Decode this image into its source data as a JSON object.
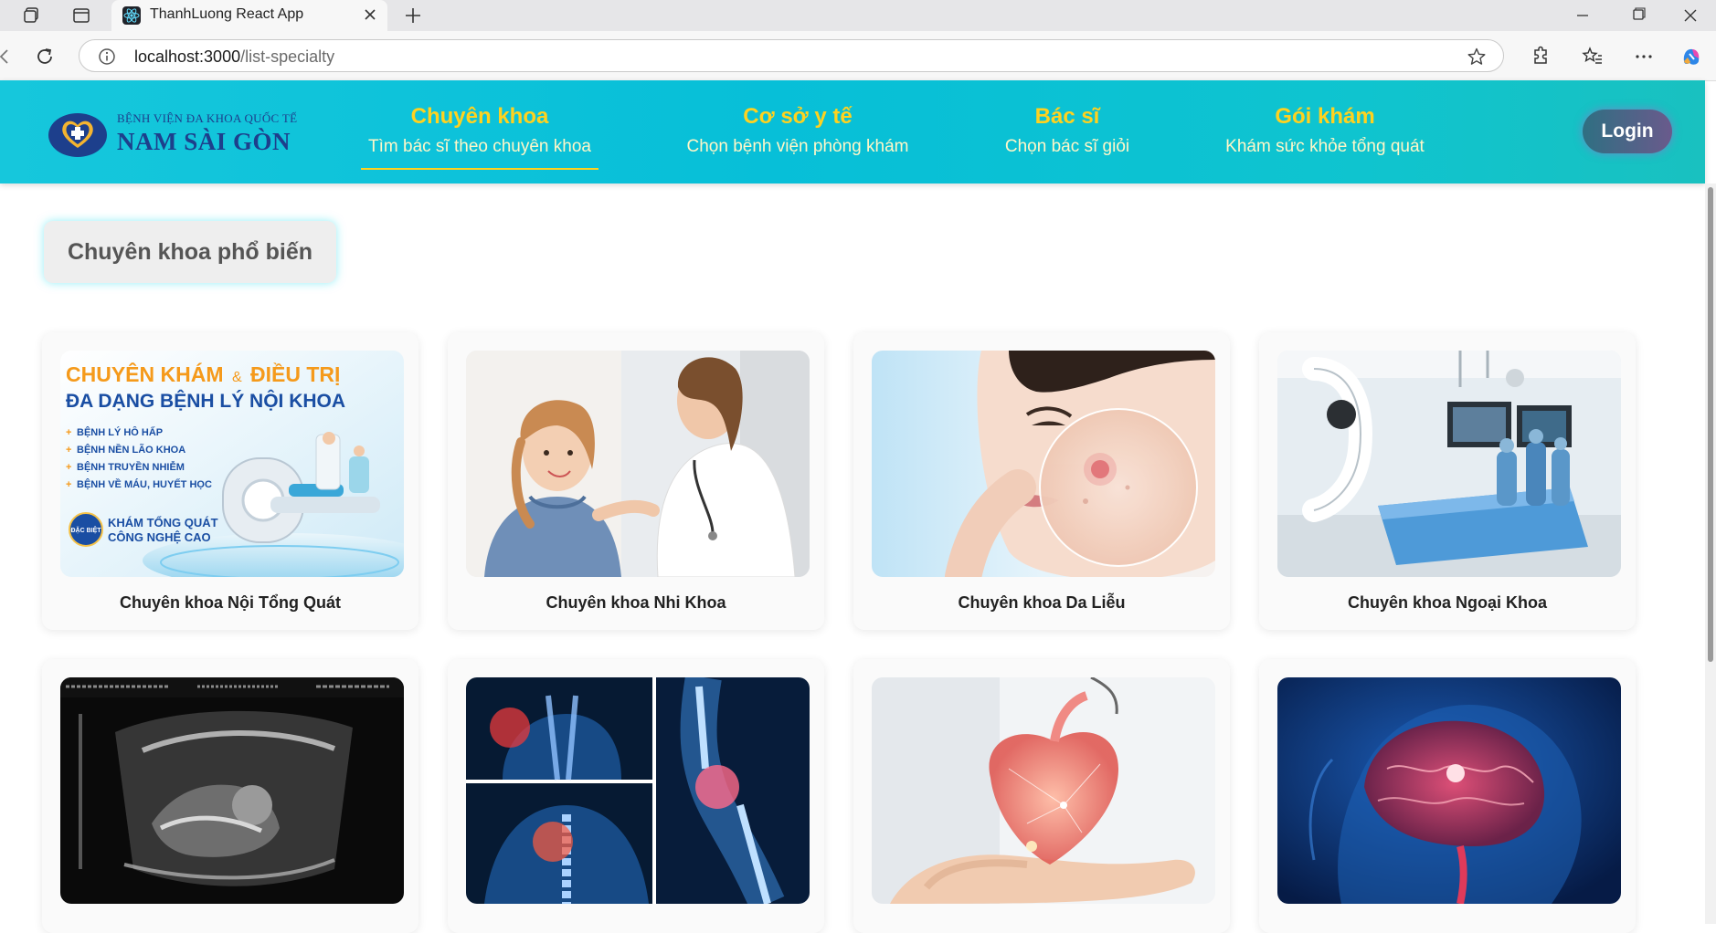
{
  "browser": {
    "tab_title": "ThanhLuong React App",
    "url_host": "localhost:3000",
    "url_path": "/list-specialty"
  },
  "header": {
    "logo_small": "BỆNH VIỆN ĐA KHOA QUỐC TẾ",
    "logo_big": "NAM SÀI GÒN",
    "nav": [
      {
        "title": "Chuyên khoa",
        "subtitle": "Tìm bác sĩ theo chuyên khoa",
        "active": true
      },
      {
        "title": "Cơ sở y tế",
        "subtitle": "Chọn bệnh viện phòng khám",
        "active": false
      },
      {
        "title": "Bác sĩ",
        "subtitle": "Chọn bác sĩ giỏi",
        "active": false
      },
      {
        "title": "Gói khám",
        "subtitle": "Khám sức khỏe tổng quát",
        "active": false
      }
    ],
    "login_label": "Login"
  },
  "section": {
    "title": "Chuyên khoa phổ biến"
  },
  "specialties": [
    {
      "label": "Chuyên khoa Nội Tổng Quát"
    },
    {
      "label": "Chuyên khoa Nhi Khoa"
    },
    {
      "label": "Chuyên khoa Da Liễu"
    },
    {
      "label": "Chuyên khoa Ngoại Khoa"
    },
    {
      "label": ""
    },
    {
      "label": ""
    },
    {
      "label": ""
    },
    {
      "label": ""
    }
  ],
  "banner": {
    "line1a": "CHUYÊN KHÁM",
    "line1amp": "&",
    "line1b": "ĐIỀU TRỊ",
    "line2": "ĐA DẠNG BỆNH LÝ NỘI KHOA",
    "items": [
      "BỆNH LÝ HÔ HẤP",
      "BỆNH NỀN LÃO KHOA",
      "BỆNH TRUYỀN NHIỄM",
      "BỆNH VỀ MÁU, HUYẾT HỌC"
    ],
    "badge": "ĐẶC BIỆT",
    "badge_text1": "KHÁM TỔNG QUÁT",
    "badge_text2": "CÔNG NGHỆ CAO"
  },
  "colors": {
    "header_bg": "#07bfd8",
    "nav_title": "#ffd21f",
    "logo": "#1d3f8c"
  }
}
